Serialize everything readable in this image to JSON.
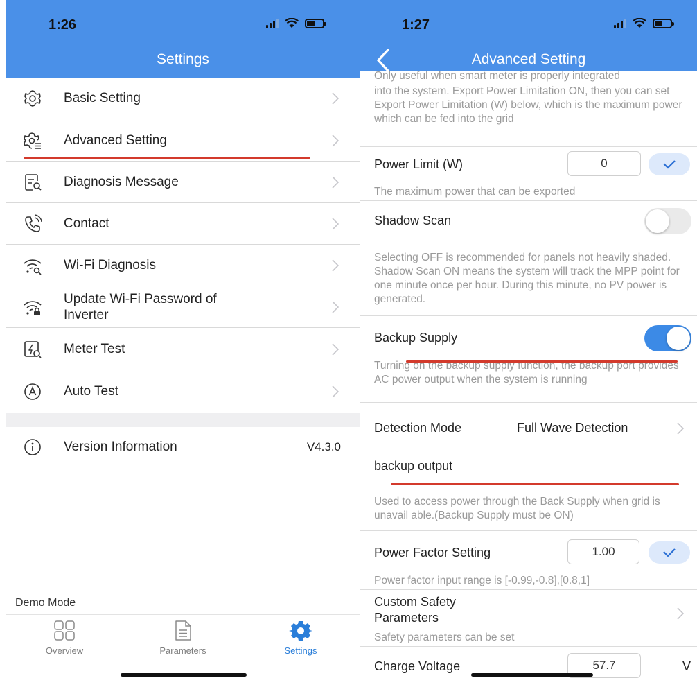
{
  "left": {
    "time": "1:26",
    "title": "Settings",
    "items": [
      {
        "label": "Basic Setting",
        "icon": "gear-icon"
      },
      {
        "label": "Advanced Setting",
        "icon": "gear-list-icon"
      },
      {
        "label": "Diagnosis Message",
        "icon": "document-search-icon"
      },
      {
        "label": "Contact",
        "icon": "phone-icon"
      },
      {
        "label": "Wi-Fi Diagnosis",
        "icon": "wifi-search-icon"
      },
      {
        "label": "Update Wi-Fi Password of Inverter",
        "icon": "wifi-lock-icon"
      },
      {
        "label": "Meter Test",
        "icon": "meter-search-icon"
      },
      {
        "label": "Auto Test",
        "icon": "auto-a-icon"
      }
    ],
    "version": {
      "label": "Version Information",
      "value": "V4.3.0"
    },
    "demo_mode": "Demo Mode",
    "tabs": [
      {
        "label": "Overview",
        "icon": "grid-icon"
      },
      {
        "label": "Parameters",
        "icon": "document-icon"
      },
      {
        "label": "Settings",
        "icon": "gear-icon",
        "active": true
      }
    ]
  },
  "right": {
    "time": "1:27",
    "title": "Advanced Setting",
    "top_text_cut": "Only useful when smart meter is properly integrated",
    "top_text": "into the system. Export Power Limitation ON, then you can set Export Power Limitation (W) below, which is the maximum power which can be fed into the grid",
    "power_limit": {
      "label": "Power Limit (W)",
      "value": "0",
      "hint": "The maximum power that can be exported"
    },
    "shadow_scan": {
      "label": "Shadow Scan",
      "on": false,
      "hint": "Selecting OFF is recommended for panels not heavily shaded. Shadow Scan ON means the system will track the MPP point for one minute once per hour. During this minute, no PV power is generated."
    },
    "backup_supply": {
      "label": "Backup Supply",
      "on": true,
      "hint": "Turning on the backup supply function, the backup port provides AC power output when the system is running"
    },
    "detection_mode": {
      "label": "Detection Mode",
      "value": "Full Wave Detection"
    },
    "backup_output": {
      "label": "backup output",
      "hint": "Used to access power through the Back Supply when grid is unavail able.(Backup Supply must be ON)"
    },
    "power_factor": {
      "label": "Power Factor Setting",
      "value": "1.00",
      "hint": "Power factor input range is [-0.99,-0.8],[0.8,1]"
    },
    "custom_safety": {
      "label": "Custom Safety Parameters",
      "hint": "Safety parameters can be set"
    },
    "charge_voltage": {
      "label": "Charge Voltage",
      "value": "57.7",
      "unit": "V"
    }
  },
  "colors": {
    "accent": "#4a90e8",
    "annotation": "#d33a2c",
    "toggle_on": "#3c8ae6"
  }
}
